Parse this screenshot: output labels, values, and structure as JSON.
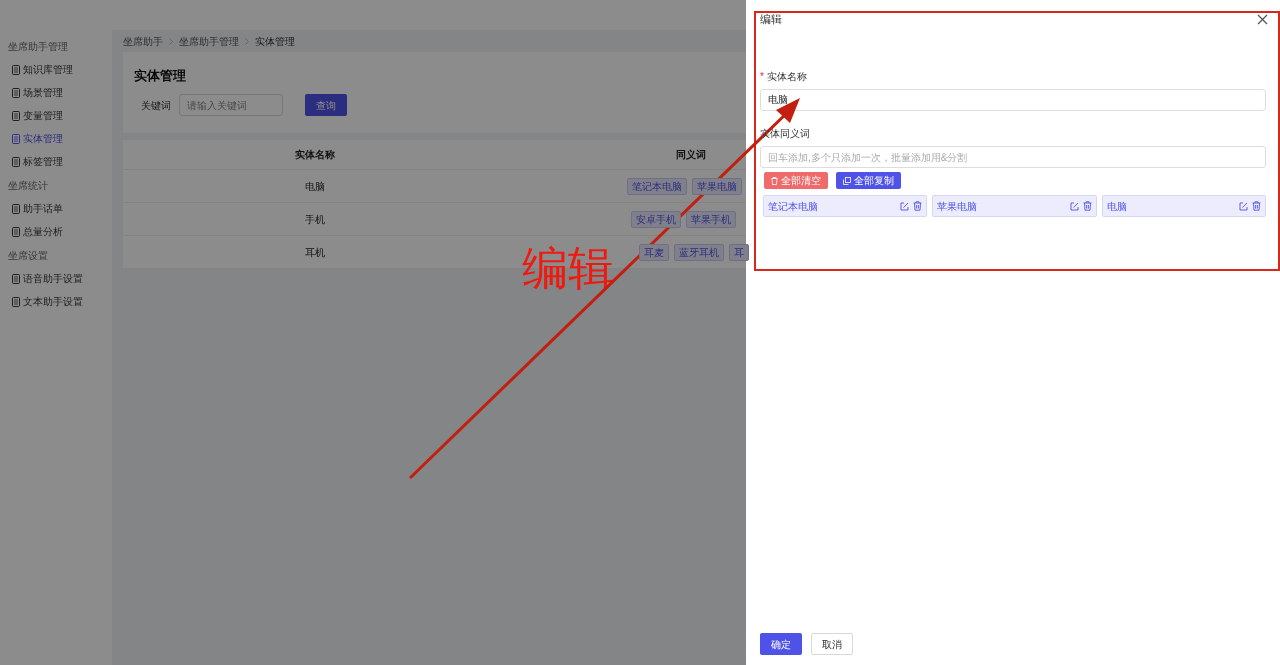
{
  "sidebar": {
    "groups": [
      {
        "label": "坐席助手管理",
        "items": [
          {
            "label": "知识库管理",
            "selected": false
          },
          {
            "label": "场景管理",
            "selected": false
          },
          {
            "label": "变量管理",
            "selected": false
          },
          {
            "label": "实体管理",
            "selected": true
          },
          {
            "label": "标签管理",
            "selected": false
          }
        ]
      },
      {
        "label": "坐席统计",
        "items": [
          {
            "label": "助手话单",
            "selected": false
          },
          {
            "label": "总量分析",
            "selected": false
          }
        ]
      },
      {
        "label": "坐席设置",
        "items": [
          {
            "label": "语音助手设置",
            "selected": false
          },
          {
            "label": "文本助手设置",
            "selected": false
          }
        ]
      }
    ]
  },
  "breadcrumb": [
    "坐席助手",
    "坐席助手管理",
    "实体管理"
  ],
  "page": {
    "title": "实体管理",
    "search_label": "关键词",
    "search_placeholder": "请输入关键词",
    "search_button": "查询"
  },
  "table": {
    "columns": [
      "实体名称",
      "同义词"
    ],
    "rows": [
      {
        "name": "电脑",
        "synonyms": [
          "笔记本电脑",
          "苹果电脑"
        ]
      },
      {
        "name": "手机",
        "synonyms": [
          "安卓手机",
          "苹果手机"
        ]
      },
      {
        "name": "耳机",
        "synonyms": [
          "耳麦",
          "蓝牙耳机",
          "耳"
        ]
      }
    ]
  },
  "drawer": {
    "title": "编辑",
    "name_field": {
      "label": "实体名称",
      "required_mark": "*",
      "value": "电脑"
    },
    "synonym_field": {
      "label": "实体同义词",
      "placeholder": "回车添加,多个只添加一次，批量添加用&分割"
    },
    "clear_button": "全部清空",
    "copy_button": "全部复制",
    "synonyms": [
      "笔记本电脑",
      "苹果电脑",
      "电脑"
    ],
    "ok_button": "确定",
    "cancel_button": "取消"
  },
  "annotation": {
    "text": "编辑"
  }
}
